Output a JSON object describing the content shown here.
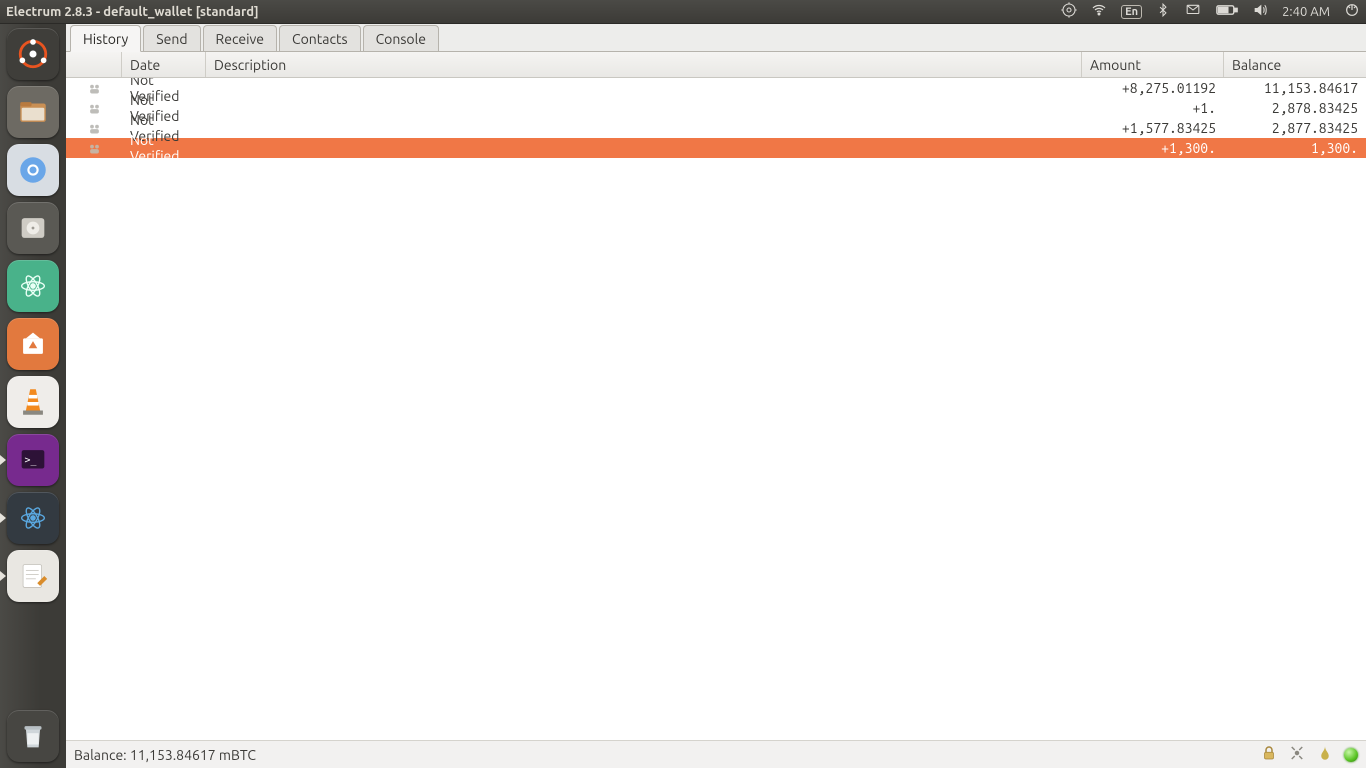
{
  "os_bar": {
    "title": "Electrum 2.8.3  -  default_wallet  [standard]",
    "lang": "En",
    "clock": "2:40 AM"
  },
  "launcher": {
    "items": [
      {
        "name": "dash",
        "bg": "#3f3e3a"
      },
      {
        "name": "files",
        "bg": "#6d6a63"
      },
      {
        "name": "chromium",
        "bg": "#d8dde3"
      },
      {
        "name": "disks",
        "bg": "#5a5954"
      },
      {
        "name": "atom-green",
        "bg": "#49b28a"
      },
      {
        "name": "software",
        "bg": "#e2793e"
      },
      {
        "name": "vlc",
        "bg": "#efedea"
      },
      {
        "name": "terminal",
        "bg": "#772a8e"
      },
      {
        "name": "atom-blue",
        "bg": "#333a41"
      },
      {
        "name": "gedit",
        "bg": "#e9e7e2"
      }
    ],
    "trash": {
      "name": "trash",
      "bg": "#474642"
    }
  },
  "tabs": [
    {
      "id": "history",
      "label": "History",
      "active": true
    },
    {
      "id": "send",
      "label": "Send",
      "active": false
    },
    {
      "id": "receive",
      "label": "Receive",
      "active": false
    },
    {
      "id": "contacts",
      "label": "Contacts",
      "active": false
    },
    {
      "id": "console",
      "label": "Console",
      "active": false
    }
  ],
  "columns": {
    "date": "Date",
    "description": "Description",
    "amount": "Amount",
    "balance": "Balance"
  },
  "transactions": [
    {
      "date": "Not Verified",
      "description": "",
      "amount": "+8,275.01192",
      "balance": "11,153.84617",
      "selected": false
    },
    {
      "date": "Not Verified",
      "description": "",
      "amount": "+1.",
      "balance": "2,878.83425",
      "selected": false
    },
    {
      "date": "Not Verified",
      "description": "",
      "amount": "+1,577.83425",
      "balance": "2,877.83425",
      "selected": false
    },
    {
      "date": "Not Verified",
      "description": "",
      "amount": "+1,300.",
      "balance": "1,300.",
      "selected": true
    }
  ],
  "status_bar": {
    "balance_text": "Balance: 11,153.84617 mBTC"
  }
}
